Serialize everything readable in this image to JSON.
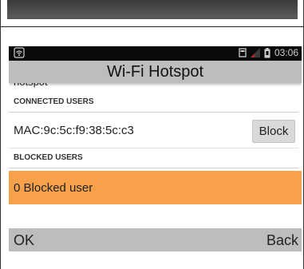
{
  "status_bar": {
    "time": "03:06",
    "icons": [
      "wifi-icon",
      "sd-card-icon",
      "signal-icon",
      "battery-icon"
    ]
  },
  "title": "Wi-Fi Hotspot",
  "clipped_text": "hotspot",
  "connected_users": {
    "header": "CONNECTED USERS",
    "items": [
      {
        "mac": "MAC:9c:5c:f9:38:5c:c3",
        "action": "Block"
      }
    ]
  },
  "blocked_users": {
    "header": "BLOCKED USERS",
    "summary": "0 Blocked user"
  },
  "softkeys": {
    "left": "OK",
    "right": "Back"
  },
  "colors": {
    "highlight": "#f7a14b",
    "bars": "#bdbdbd",
    "status_bar": "#0a0a0a"
  }
}
